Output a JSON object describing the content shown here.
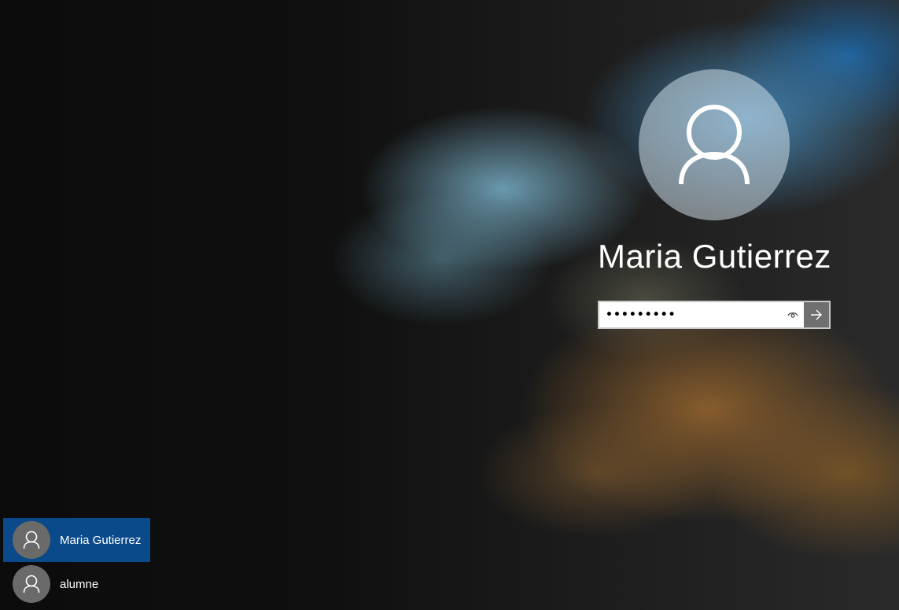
{
  "login": {
    "user_name": "Maria Gutierrez",
    "password_value": "•••••••••",
    "avatar_icon": "user-icon",
    "reveal_icon": "eye-icon",
    "submit_icon": "arrow-right-icon"
  },
  "user_list": {
    "items": [
      {
        "label": "Maria Gutierrez",
        "selected": true,
        "icon": "user-icon"
      },
      {
        "label": "alumne",
        "selected": false,
        "icon": "user-icon"
      }
    ]
  },
  "colors": {
    "selected_user": "#0b4a8a",
    "submit_button": "#6f6f6f"
  }
}
